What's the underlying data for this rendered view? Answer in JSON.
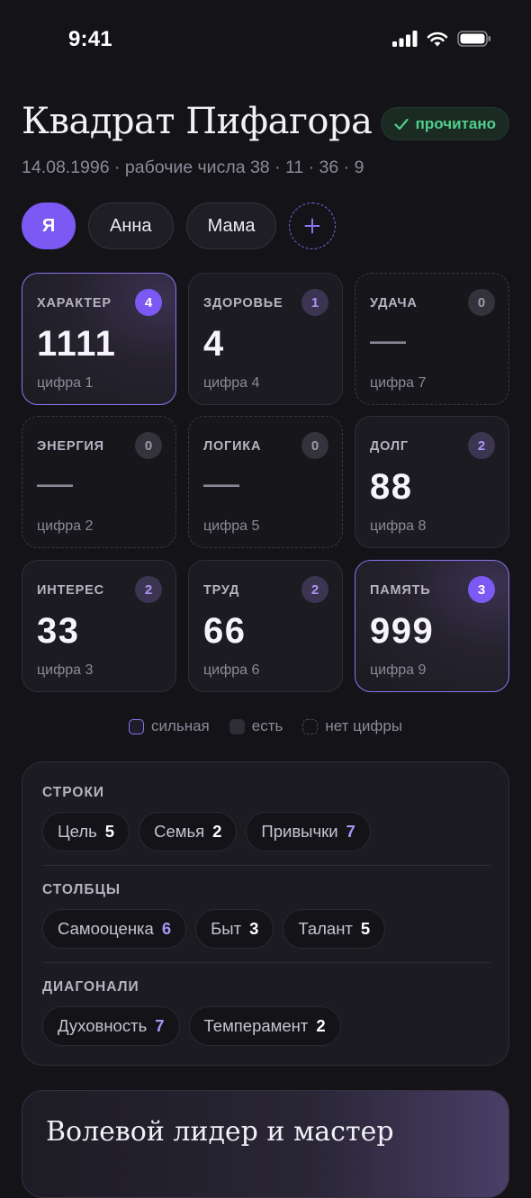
{
  "status_bar": {
    "time": "9:41"
  },
  "header": {
    "title": "Квадрат Пифагора",
    "badge_label": "прочитано",
    "subtitle": "14.08.1996 · рабочие числа 38 · 11 · 36 · 9"
  },
  "profiles": {
    "items": [
      {
        "label": "Я",
        "active": true
      },
      {
        "label": "Анна",
        "active": false
      },
      {
        "label": "Мама",
        "active": false
      }
    ]
  },
  "grid": {
    "cells": [
      {
        "label": "ХАРАКТЕР",
        "count": "4",
        "value": "1111",
        "digit": "цифра 1",
        "state": "strong"
      },
      {
        "label": "ЗДОРОВЬЕ",
        "count": "1",
        "value": "4",
        "digit": "цифра 4",
        "state": "have"
      },
      {
        "label": "УДАЧА",
        "count": "0",
        "value": "—",
        "digit": "цифра 7",
        "state": "none"
      },
      {
        "label": "ЭНЕРГИЯ",
        "count": "0",
        "value": "—",
        "digit": "цифра 2",
        "state": "none"
      },
      {
        "label": "ЛОГИКА",
        "count": "0",
        "value": "—",
        "digit": "цифра 5",
        "state": "none"
      },
      {
        "label": "ДОЛГ",
        "count": "2",
        "value": "88",
        "digit": "цифра 8",
        "state": "have"
      },
      {
        "label": "ИНТЕРЕС",
        "count": "2",
        "value": "33",
        "digit": "цифра 3",
        "state": "have"
      },
      {
        "label": "ТРУД",
        "count": "2",
        "value": "66",
        "digit": "цифра 6",
        "state": "have"
      },
      {
        "label": "ПАМЯТЬ",
        "count": "3",
        "value": "999",
        "digit": "цифра 9",
        "state": "strong"
      }
    ]
  },
  "legend": {
    "strong": "сильная",
    "have": "есть",
    "none": "нет цифры"
  },
  "lines": {
    "rows_title": "СТРОКИ",
    "rows": [
      {
        "label": "Цель",
        "value": "5"
      },
      {
        "label": "Семья",
        "value": "2"
      },
      {
        "label": "Привычки",
        "value": "7"
      }
    ],
    "columns_title": "СТОЛБЦЫ",
    "columns": [
      {
        "label": "Самооценка",
        "value": "6"
      },
      {
        "label": "Быт",
        "value": "3"
      },
      {
        "label": "Талант",
        "value": "5"
      }
    ],
    "diagonals_title": "ДИАГОНАЛИ",
    "diagonals": [
      {
        "label": "Духовность",
        "value": "7"
      },
      {
        "label": "Темперамент",
        "value": "2"
      }
    ]
  },
  "result": {
    "title": "Волевой лидер и мастер"
  },
  "colors": {
    "accent": "#7b59f2",
    "accent_light": "#a997f6",
    "success": "#4fcf8b",
    "background": "#141317"
  },
  "icons": {
    "badge": "check-icon",
    "add_profile": "plus-icon",
    "status": [
      "signal-icon",
      "wifi-icon",
      "battery-icon"
    ]
  }
}
